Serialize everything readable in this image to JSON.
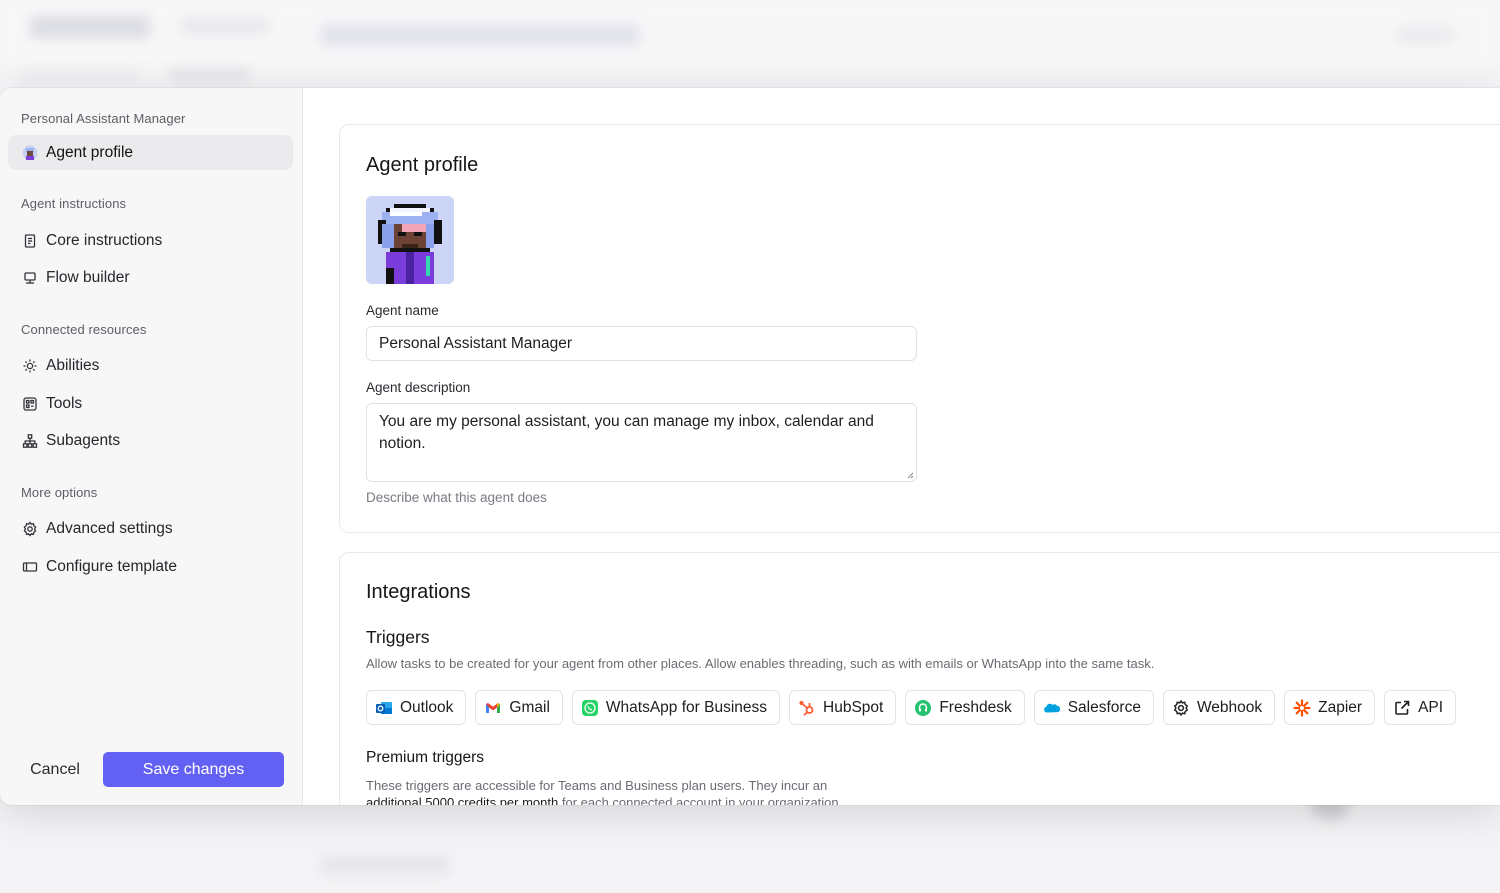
{
  "sidebar": {
    "agent_title": "Personal Assistant Manager",
    "items_profile": [
      {
        "label": "Agent profile",
        "icon": "agent-avatar-icon",
        "active": true
      }
    ],
    "section_instructions": "Agent instructions",
    "items_instructions": [
      {
        "label": "Core instructions",
        "icon": "document-icon"
      },
      {
        "label": "Flow builder",
        "icon": "monitor-icon"
      }
    ],
    "section_resources": "Connected resources",
    "items_resources": [
      {
        "label": "Abilities",
        "icon": "sparkle-icon"
      },
      {
        "label": "Tools",
        "icon": "tools-grid-icon"
      },
      {
        "label": "Subagents",
        "icon": "hierarchy-icon"
      }
    ],
    "section_more": "More options",
    "items_more": [
      {
        "label": "Advanced settings",
        "icon": "gear-icon"
      },
      {
        "label": "Configure template",
        "icon": "template-icon"
      }
    ],
    "cancel_label": "Cancel",
    "save_label": "Save changes"
  },
  "profile": {
    "heading": "Agent profile",
    "name_label": "Agent name",
    "name_value": "Personal Assistant Manager",
    "description_label": "Agent description",
    "description_value": "You are my personal assistant, you can manage my inbox, calendar and notion.",
    "description_help": "Describe what this agent does"
  },
  "integrations": {
    "heading": "Integrations",
    "triggers_heading": "Triggers",
    "triggers_desc": "Allow tasks to be created for your agent from other places. Allow enables threading, such as with emails or WhatsApp into the same task.",
    "triggers": [
      {
        "label": "Outlook",
        "icon": "outlook-icon"
      },
      {
        "label": "Gmail",
        "icon": "gmail-icon"
      },
      {
        "label": "WhatsApp for Business",
        "icon": "whatsapp-icon"
      },
      {
        "label": "HubSpot",
        "icon": "hubspot-icon"
      },
      {
        "label": "Freshdesk",
        "icon": "freshdesk-icon"
      },
      {
        "label": "Salesforce",
        "icon": "salesforce-icon"
      },
      {
        "label": "Webhook",
        "icon": "webhook-gear-icon"
      },
      {
        "label": "Zapier",
        "icon": "zapier-icon"
      },
      {
        "label": "API",
        "icon": "external-link-icon"
      }
    ],
    "premium_heading": "Premium triggers",
    "premium_desc_1": "These triggers are accessible for Teams and Business plan users. They incur an",
    "premium_desc_strong": "additional 5000 credits per month",
    "premium_desc_2": " for each connected account in your organization."
  },
  "colors": {
    "accent": "#6361f4",
    "sidebar_bg": "#f7f7f8",
    "active_item_bg": "#ebebee"
  }
}
